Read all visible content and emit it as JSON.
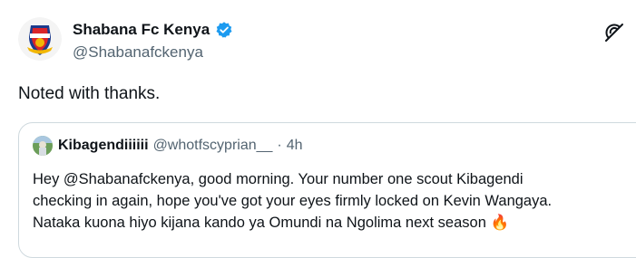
{
  "tweet": {
    "author": {
      "display_name": "Shabana Fc Kenya",
      "handle": "@Shabanafckenya",
      "avatar_icon": "shabana-fc-crest-icon",
      "verified_color": "#1d9bf0"
    },
    "text": "Noted with thanks.",
    "grok_icon": "grok-icon"
  },
  "quoted_tweet": {
    "display_name": "Kibagendiiiiii",
    "handle": "@whotfscyprian__",
    "separator": "·",
    "time": "4h",
    "lines": [
      "Hey @Shabanafckenya, good morning. Your number one scout Kibagendi",
      "checking in again, hope you've got your eyes firmly locked on Kevin Wangaya.",
      "Nataka kuona hiyo kijana kando ya Omundi na Ngolima next season"
    ],
    "emoji": "🔥"
  },
  "colors": {
    "text_primary": "#0f1419",
    "text_secondary": "#536471",
    "border": "#cfd9de"
  }
}
